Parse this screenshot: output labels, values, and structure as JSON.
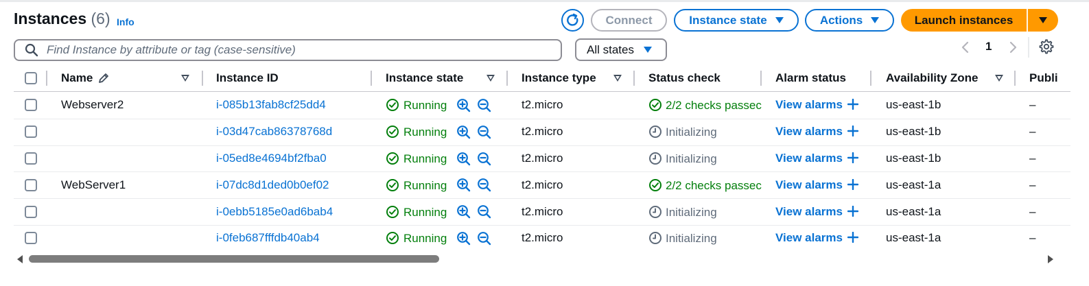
{
  "header": {
    "title": "Instances",
    "count": "(6)",
    "info_link": "Info"
  },
  "toolbar": {
    "connect": "Connect",
    "instance_state": "Instance state",
    "actions": "Actions",
    "launch": "Launch instances"
  },
  "filter": {
    "search_placeholder": "Find Instance by attribute or tag (case-sensitive)",
    "states_select": "All states"
  },
  "pagination": {
    "page": "1"
  },
  "columns": {
    "name": "Name",
    "instance_id": "Instance ID",
    "instance_state": "Instance state",
    "instance_type": "Instance type",
    "status_check": "Status check",
    "alarm_status": "Alarm status",
    "availability_zone": "Availability Zone",
    "public": "Publi"
  },
  "rows": [
    {
      "name": "Webserver2",
      "id": "i-085b13fab8cf25dd4",
      "state": "Running",
      "type": "t2.micro",
      "status": "2/2 checks passec",
      "status_kind": "passed",
      "alarm": "View alarms",
      "zone": "us-east-1b",
      "public": "–"
    },
    {
      "name": "",
      "id": "i-03d47cab86378768d",
      "state": "Running",
      "type": "t2.micro",
      "status": "Initializing",
      "status_kind": "init",
      "alarm": "View alarms",
      "zone": "us-east-1b",
      "public": "–"
    },
    {
      "name": "",
      "id": "i-05ed8e4694bf2fba0",
      "state": "Running",
      "type": "t2.micro",
      "status": "Initializing",
      "status_kind": "init",
      "alarm": "View alarms",
      "zone": "us-east-1b",
      "public": "–"
    },
    {
      "name": "WebServer1",
      "id": "i-07dc8d1ded0b0ef02",
      "state": "Running",
      "type": "t2.micro",
      "status": "2/2 checks passec",
      "status_kind": "passed",
      "alarm": "View alarms",
      "zone": "us-east-1a",
      "public": "–"
    },
    {
      "name": "",
      "id": "i-0ebb5185e0ad6bab4",
      "state": "Running",
      "type": "t2.micro",
      "status": "Initializing",
      "status_kind": "init",
      "alarm": "View alarms",
      "zone": "us-east-1a",
      "public": "–"
    },
    {
      "name": "",
      "id": "i-0feb687fffdb40ab4",
      "state": "Running",
      "type": "t2.micro",
      "status": "Initializing",
      "status_kind": "init",
      "alarm": "View alarms",
      "zone": "us-east-1a",
      "public": "–"
    }
  ],
  "colors": {
    "link": "#0972d3",
    "success": "#037f0c",
    "launch": "#ff9900",
    "muted": "#5f6b7a"
  }
}
